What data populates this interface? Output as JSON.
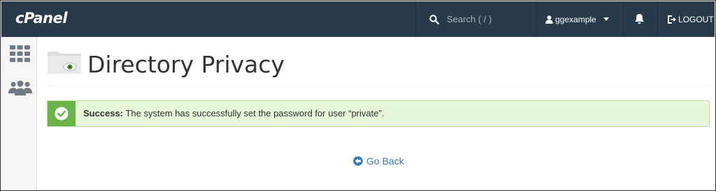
{
  "header": {
    "logo": "cPanel",
    "search": {
      "placeholder": "Search ( / )",
      "value": ""
    },
    "user": {
      "name": "ggexample"
    },
    "logout_label": "LOGOUT"
  },
  "sidebar": {
    "items": [
      {
        "icon": "grid-icon"
      },
      {
        "icon": "users-icon"
      }
    ]
  },
  "page": {
    "title": "Directory Privacy",
    "icon": "folder-eye-icon"
  },
  "alert": {
    "type": "success",
    "label": "Success:",
    "message": "The system has successfully set the password for user “private”.",
    "color": "#6ab547"
  },
  "actions": {
    "go_back_label": "Go Back"
  },
  "colors": {
    "topbar": "#293a4a",
    "link": "#337ab7",
    "alert_bg": "#e6f6d9"
  }
}
